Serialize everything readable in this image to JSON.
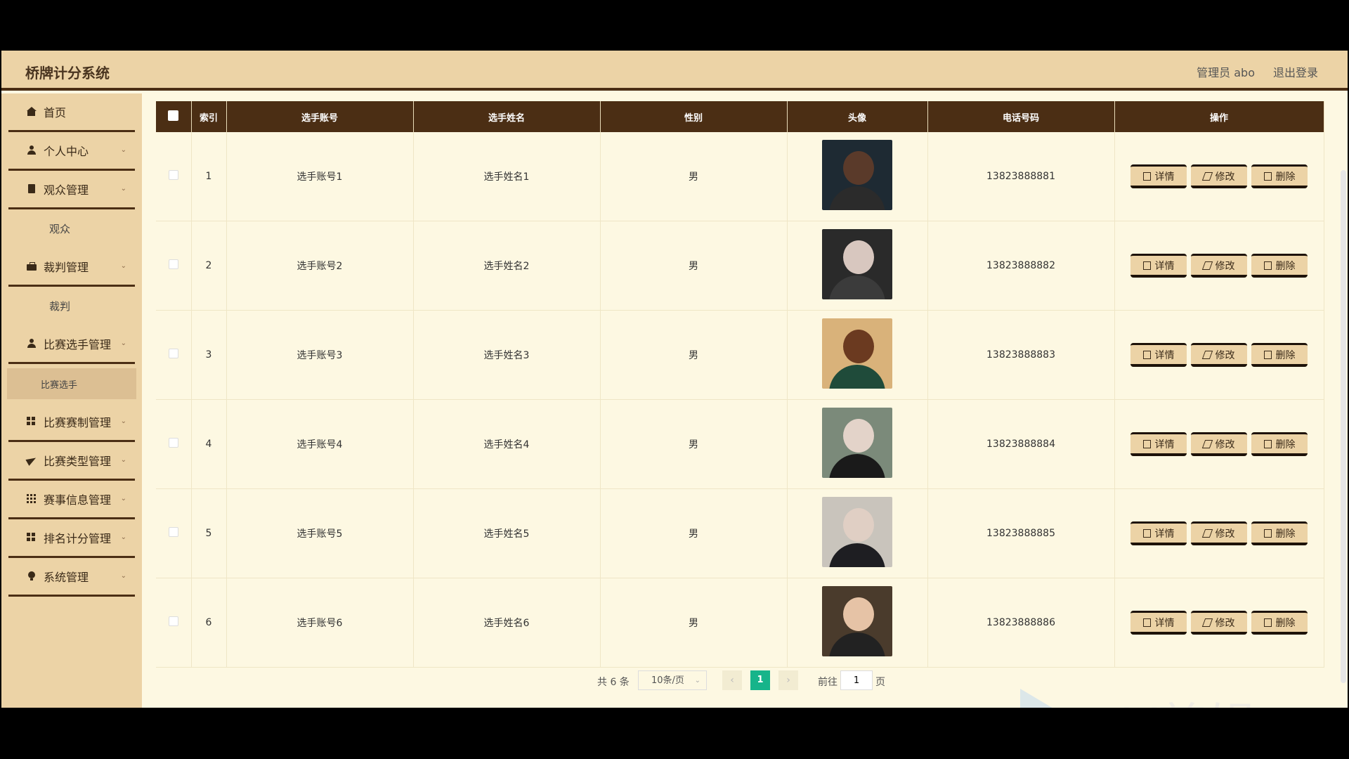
{
  "header": {
    "title": "桥牌计分系统",
    "user": "管理员 abo",
    "logout": "退出登录"
  },
  "sidebar": {
    "items": [
      {
        "label": "首页",
        "icon": "home-icon"
      },
      {
        "label": "个人中心",
        "icon": "person-icon"
      },
      {
        "label": "观众管理",
        "icon": "document-icon"
      },
      {
        "sub": "观众"
      },
      {
        "label": "裁判管理",
        "icon": "briefcase-icon"
      },
      {
        "sub": "裁判"
      },
      {
        "label": "比赛选手管理",
        "icon": "person-icon"
      },
      {
        "sub": "比赛选手",
        "active": true
      },
      {
        "label": "比赛赛制管理",
        "icon": "grid-icon"
      },
      {
        "label": "比赛类型管理",
        "icon": "send-icon"
      },
      {
        "label": "赛事信息管理",
        "icon": "apps-icon"
      },
      {
        "label": "排名计分管理",
        "icon": "grid-icon"
      },
      {
        "label": "系统管理",
        "icon": "bulb-icon"
      }
    ]
  },
  "table": {
    "headers": [
      "索引",
      "选手账号",
      "选手姓名",
      "性别",
      "头像",
      "电话号码",
      "操作"
    ],
    "rows": [
      {
        "index": "1",
        "account": "选手账号1",
        "name": "选手姓名1",
        "gender": "男",
        "phone": "13823888881"
      },
      {
        "index": "2",
        "account": "选手账号2",
        "name": "选手姓名2",
        "gender": "男",
        "phone": "13823888882"
      },
      {
        "index": "3",
        "account": "选手账号3",
        "name": "选手姓名3",
        "gender": "男",
        "phone": "13823888883"
      },
      {
        "index": "4",
        "account": "选手账号4",
        "name": "选手姓名4",
        "gender": "男",
        "phone": "13823888884"
      },
      {
        "index": "5",
        "account": "选手账号5",
        "name": "选手姓名5",
        "gender": "男",
        "phone": "13823888885"
      },
      {
        "index": "6",
        "account": "选手账号6",
        "name": "选手姓名6",
        "gender": "男",
        "phone": "13823888886"
      }
    ],
    "actions": {
      "detail": "详情",
      "edit": "修改",
      "delete": "删除"
    }
  },
  "pager": {
    "total": "共 6 条",
    "size": "10条/页",
    "current": "1",
    "goto": "前往",
    "goto_value": "1",
    "page_word": "页"
  },
  "watermark": {
    "text": "eV剪辑"
  },
  "colors": {
    "header_bg": "#ecd3a6",
    "table_head": "#4b2e14",
    "accent": "#17b48a",
    "content_bg": "#fdf8e2"
  }
}
